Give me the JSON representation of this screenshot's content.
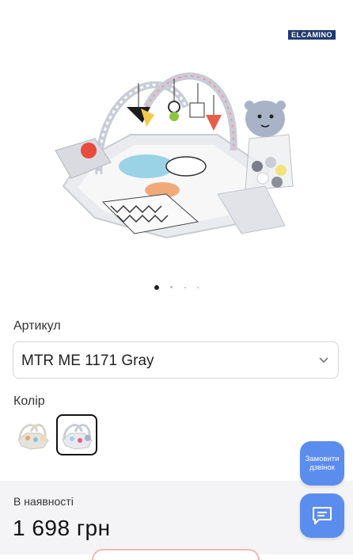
{
  "brand": {
    "logo_text": "ELCAMINO"
  },
  "gallery": {
    "slide_count": 4,
    "active_slide": 1
  },
  "product": {
    "sku_label": "Артикул",
    "sku_value": "MTR ME 1171 Gray",
    "color_label": "Колір",
    "color_swatches": [
      {
        "name": "beige",
        "selected": false
      },
      {
        "name": "gray",
        "selected": true
      }
    ]
  },
  "stock": {
    "status": "В наявності",
    "price": "1 698 грн"
  },
  "floating": {
    "callback_label": "Замовити дзвінок",
    "chat_icon": "chat-icon"
  },
  "colors": {
    "accent": "#5b8def",
    "panel_bg": "#f4f4f6",
    "logo_bg": "#1f3b6e"
  }
}
